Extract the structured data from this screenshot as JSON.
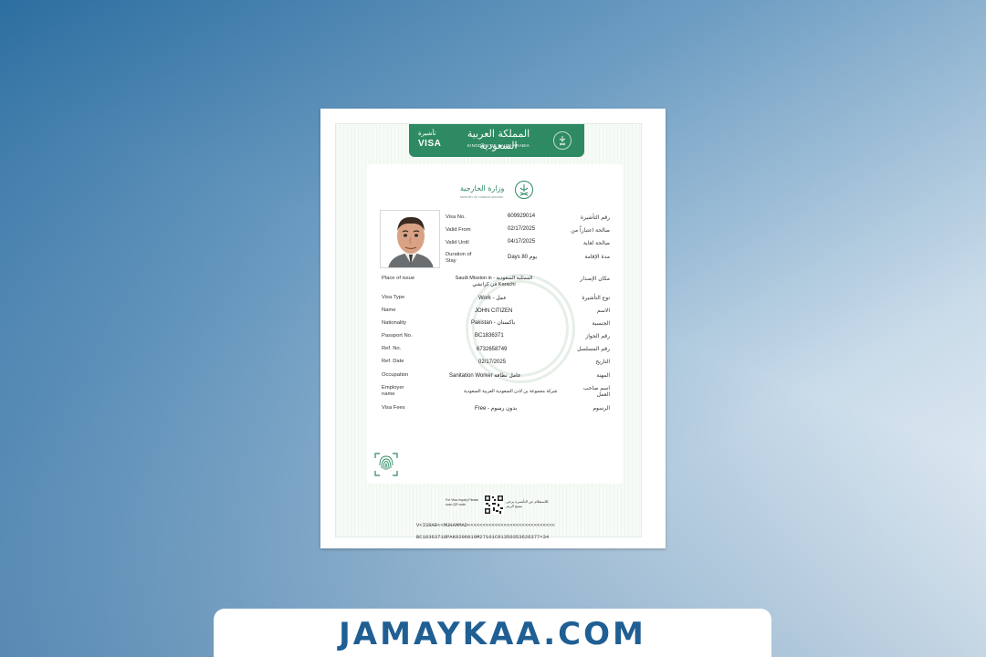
{
  "header": {
    "visa_ar": "تأشيرة",
    "visa_en": "VISA",
    "kingdom_ar": "المملكة العربية السعودية",
    "kingdom_en": "KINGDOM OF SAUDI ARABIA",
    "emblem_icon": "saudi-emblem",
    "band_color": "#2e8a63"
  },
  "ministry": {
    "name_ar": "وزارة الخارجية",
    "name_en": "MINISTRY OF FOREIGN AFFAIRS"
  },
  "fields": {
    "visa_no": {
      "label": "Visa No.",
      "value": "609929014",
      "label_ar": "رقم التأشيرة"
    },
    "valid_from": {
      "label": "Valid From",
      "value": "02/17/2025",
      "label_ar": "صالحة اعتباراً من"
    },
    "valid_until": {
      "label": "Valid Until",
      "value": "04/17/2025",
      "label_ar": "صالحة لغاية"
    },
    "duration": {
      "label": "Duration of Stay",
      "value": "Days 80 يوم",
      "label_ar": "مدة الإقامة"
    },
    "place_of_issue": {
      "label": "Place of issue",
      "value": "Saudi Mission in - الممثلية السعودية في كراتشي Karachi",
      "label_ar": "مكان الإصدار"
    },
    "visa_type": {
      "label": "Visa Type",
      "value": "Work - عمل",
      "label_ar": "نوع التأشيرة"
    },
    "name": {
      "label": "Name",
      "value": "JOHN CITIZEN",
      "label_ar": "الاسم"
    },
    "nationality": {
      "label": "Nationality",
      "value": "Pakistan - باكستان",
      "label_ar": "الجنسية"
    },
    "passport_no": {
      "label": "Passport No.",
      "value": "BC1836371",
      "label_ar": "رقم الجواز"
    },
    "ref_no": {
      "label": "Ref. No.",
      "value": "6732658749",
      "label_ar": "رقم المسلسل"
    },
    "ref_date": {
      "label": "Ref. Date",
      "value": "02/17/2025",
      "label_ar": "التاريخ"
    },
    "occupation": {
      "label": "Occupation",
      "value": "Sanitation Worker عامل نظافة",
      "label_ar": "المهنة"
    },
    "employer": {
      "label": "Employer name",
      "value": "شركة مجموعة بن لادن السعودية العربية السعودية",
      "label_ar": "اسم صاحب العمل"
    },
    "visa_fees": {
      "label": "Visa Fees",
      "value": "Free - بدون رسوم",
      "label_ar": "الرسوم"
    }
  },
  "icons": {
    "photo": "passport-photo",
    "fingerprint": "fingerprint-icon",
    "qr": "qr-code-icon"
  },
  "qr_section": {
    "text_en": "For Visa Inquiry Please scan QR code",
    "text_ar": "للاستعلام عن التأشيرة يرجى مسح الرمز"
  },
  "mrz": {
    "line1": "V<ISRAR<<MUHAMMAD<<<<<<<<<<<<<<<<<<<<<<<<<<<<<",
    "line2": "BC18363718PAK0206019M27101C91350353626377<34"
  },
  "footer": {
    "site": "JAMAYKAA.COM"
  }
}
